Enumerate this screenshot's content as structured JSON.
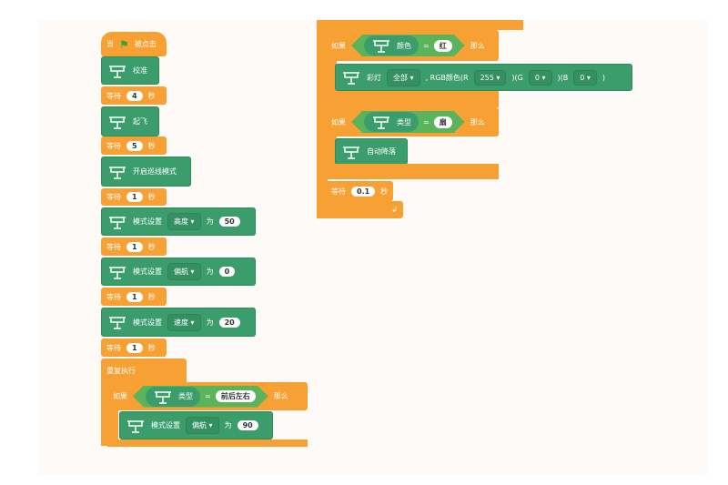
{
  "colors": {
    "control": "#f7a033",
    "drone": "#3c9d6c",
    "operator": "#5bb45b"
  },
  "left_stack": {
    "hat": {
      "when": "当",
      "flag_icon": "green-flag",
      "clicked": "被点击"
    },
    "calibrate": "校准",
    "wait1": {
      "label": "等待",
      "value": "4",
      "unit": "秒"
    },
    "takeoff": "起飞",
    "wait2": {
      "label": "等待",
      "value": "5",
      "unit": "秒"
    },
    "line_mode": "开启巡线模式",
    "wait3": {
      "label": "等待",
      "value": "1",
      "unit": "秒"
    },
    "set1": {
      "label": "模式设置",
      "option": "高度",
      "to": "为",
      "value": "50"
    },
    "wait4": {
      "label": "等待",
      "value": "1",
      "unit": "秒"
    },
    "set2": {
      "label": "模式设置",
      "option": "偏航",
      "to": "为",
      "value": "0"
    },
    "wait5": {
      "label": "等待",
      "value": "1",
      "unit": "秒"
    },
    "set3": {
      "label": "模式设置",
      "option": "速度",
      "to": "为",
      "value": "20"
    },
    "wait6": {
      "label": "等待",
      "value": "1",
      "unit": "秒"
    },
    "forever": "重复执行",
    "if1": {
      "if": "如果",
      "sensor": "类型",
      "eq": "=",
      "value": "前后左右",
      "then": "那么"
    },
    "set4": {
      "label": "模式设置",
      "option": "偏航",
      "to": "为",
      "value": "90"
    }
  },
  "right_stack": {
    "if1": {
      "if": "如果",
      "sensor": "颜色",
      "eq": "=",
      "value": "红",
      "then": "那么"
    },
    "led": {
      "label": "彩灯",
      "option": "全部",
      "rgb": ", RGB颜色(R",
      "r": "255",
      "g_label": ")(G",
      "g": "0",
      "b_label": ")(B",
      "b": "0",
      "close": ")"
    },
    "if2": {
      "if": "如果",
      "sensor": "类型",
      "eq": "=",
      "value": "扇",
      "then": "那么"
    },
    "land": "自动降落",
    "wait": {
      "label": "等待",
      "value": "0.1",
      "unit": "秒"
    },
    "loop_arrow": "↲"
  }
}
